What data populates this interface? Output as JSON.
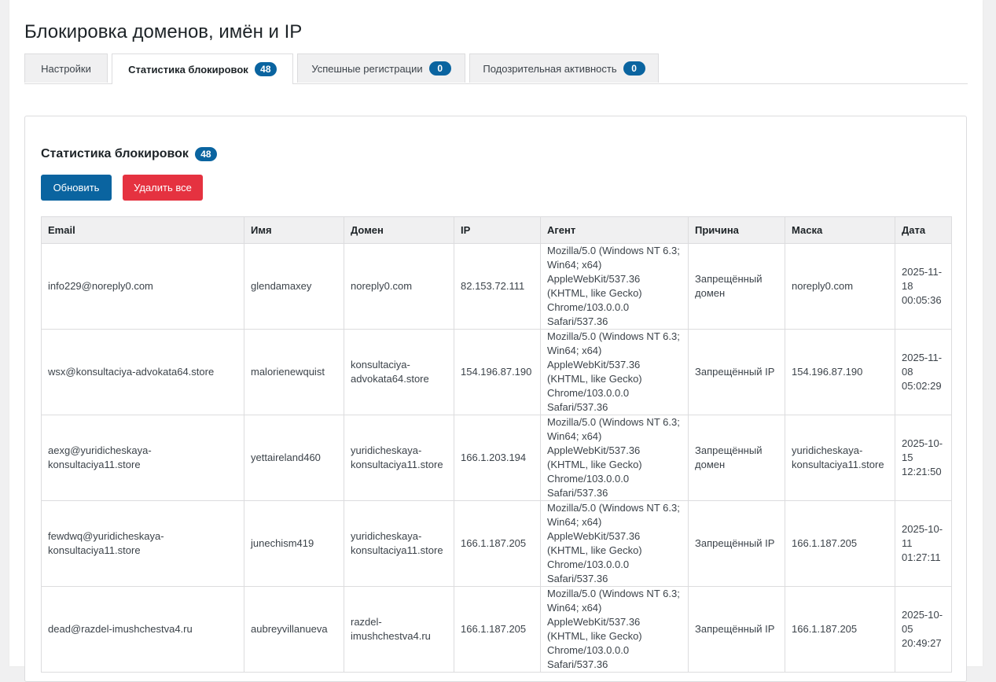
{
  "page": {
    "title": "Блокировка доменов, имён и IP"
  },
  "tabs": [
    {
      "label": "Настройки",
      "badge": null
    },
    {
      "label": "Статистика блокировок",
      "badge": "48"
    },
    {
      "label": "Успешные регистрации",
      "badge": "0"
    },
    {
      "label": "Подозрительная активность",
      "badge": "0"
    }
  ],
  "panel": {
    "title": "Статистика блокировок",
    "count": "48",
    "refresh_label": "Обновить",
    "delete_all_label": "Удалить все"
  },
  "colors": {
    "primary": "#0a64a0",
    "danger": "#e53240",
    "header_bg": "#f0f0f1"
  },
  "table": {
    "columns": [
      "Email",
      "Имя",
      "Домен",
      "IP",
      "Агент",
      "Причина",
      "Маска",
      "Дата"
    ],
    "rows": [
      {
        "email": "info229@noreply0.com",
        "name": "glendamaxey",
        "domain": "noreply0.com",
        "ip": "82.153.72.111",
        "agent": "Mozilla/5.0 (Windows NT 6.3; Win64; x64) AppleWebKit/537.36 (KHTML, like Gecko) Chrome/103.0.0.0 Safari/537.36",
        "reason": "Запрещённый домен",
        "mask": "noreply0.com",
        "date": "2025-11-18 00:05:36"
      },
      {
        "email": "wsx@konsultaciya-advokata64.store",
        "name": "malorienewquist",
        "domain": "konsultaciya-advokata64.store",
        "ip": "154.196.87.190",
        "agent": "Mozilla/5.0 (Windows NT 6.3; Win64; x64) AppleWebKit/537.36 (KHTML, like Gecko) Chrome/103.0.0.0 Safari/537.36",
        "reason": "Запрещённый IP",
        "mask": "154.196.87.190",
        "date": "2025-11-08 05:02:29"
      },
      {
        "email": "aexg@yuridicheskaya-konsultaciya11.store",
        "name": "yettaireland460",
        "domain": "yuridicheskaya-konsultaciya11.store",
        "ip": "166.1.203.194",
        "agent": "Mozilla/5.0 (Windows NT 6.3; Win64; x64) AppleWebKit/537.36 (KHTML, like Gecko) Chrome/103.0.0.0 Safari/537.36",
        "reason": "Запрещённый домен",
        "mask": "yuridicheskaya-konsultaciya11.store",
        "date": "2025-10-15 12:21:50"
      },
      {
        "email": "fewdwq@yuridicheskaya-konsultaciya11.store",
        "name": "junechism419",
        "domain": "yuridicheskaya-konsultaciya11.store",
        "ip": "166.1.187.205",
        "agent": "Mozilla/5.0 (Windows NT 6.3; Win64; x64) AppleWebKit/537.36 (KHTML, like Gecko) Chrome/103.0.0.0 Safari/537.36",
        "reason": "Запрещённый IP",
        "mask": "166.1.187.205",
        "date": "2025-10-11 01:27:11"
      },
      {
        "email": "dead@razdel-imushchestva4.ru",
        "name": "aubreyvillanueva",
        "domain": "razdel-imushchestva4.ru",
        "ip": "166.1.187.205",
        "agent": "Mozilla/5.0 (Windows NT 6.3; Win64; x64) AppleWebKit/537.36 (KHTML, like Gecko) Chrome/103.0.0.0 Safari/537.36",
        "reason": "Запрещённый IP",
        "mask": "166.1.187.205",
        "date": "2025-10-05 20:49:27"
      }
    ]
  }
}
